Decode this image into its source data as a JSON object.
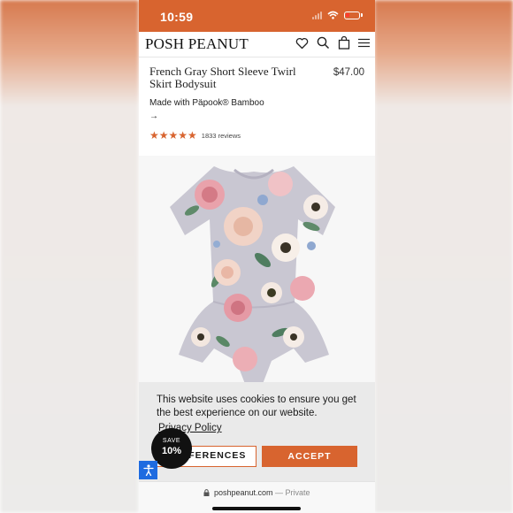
{
  "status_bar": {
    "time": "10:59"
  },
  "header": {
    "brand": "POSH PEANUT"
  },
  "product": {
    "title": "French Gray Short Sleeve Twirl Skirt Bodysuit",
    "price": "$47.00",
    "made_with": "Made with Päpook® Bamboo →",
    "rating": {
      "stars": "★★★★★",
      "reviews": "1833 reviews"
    }
  },
  "cookie_banner": {
    "message": "This website uses cookies to ensure you get the best experience on our website.",
    "policy_link": "Privacy Policy",
    "preferences_label": "PREFERENCES",
    "accept_label": "ACCEPT"
  },
  "save_badge": {
    "top": "SAVE",
    "amount": "10%"
  },
  "browser": {
    "domain": "poshpeanut.com",
    "mode": "— Private"
  },
  "colors": {
    "accent": "#d8642f",
    "a11y": "#1e6be0"
  }
}
